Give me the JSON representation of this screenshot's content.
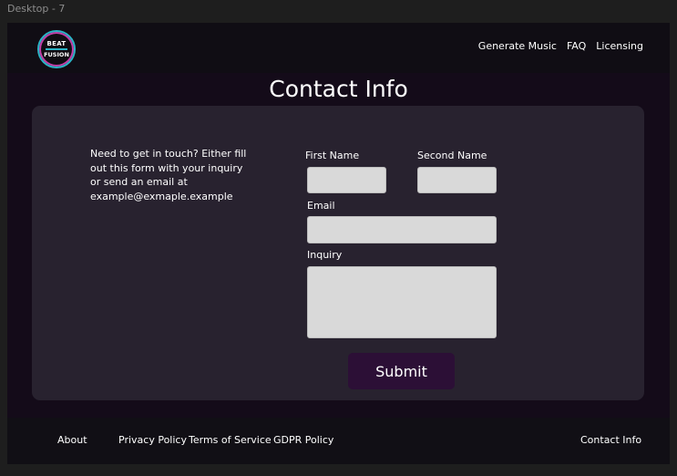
{
  "frame_label": "Desktop - 7",
  "logo": {
    "line1": "BEAT",
    "line2": "FUSION"
  },
  "nav": {
    "links": [
      "Generate Music",
      "FAQ",
      "Licensing"
    ]
  },
  "page": {
    "title": "Contact Info"
  },
  "intro": {
    "text": "Need to get in touch? Either fill out this form with your inquiry or send an email at example@exmaple.example"
  },
  "form": {
    "first_name_label": "First Name",
    "second_name_label": "Second Name",
    "email_label": "Email",
    "inquiry_label": "Inquiry",
    "first_name_value": "",
    "second_name_value": "",
    "email_value": "",
    "inquiry_value": "",
    "submit_label": "Submit"
  },
  "footer": {
    "about": "About",
    "privacy": "Privacy Policy",
    "terms": "Terms of Service",
    "gdpr": "GDPR Policy",
    "contact": "Contact Info"
  },
  "colors": {
    "page_bg": "#140b19",
    "card_bg": "#28222f",
    "submit_bg": "#2c0f36",
    "logo_accent_cyan": "#2bb3c5",
    "logo_accent_pink": "#c43fa8"
  }
}
